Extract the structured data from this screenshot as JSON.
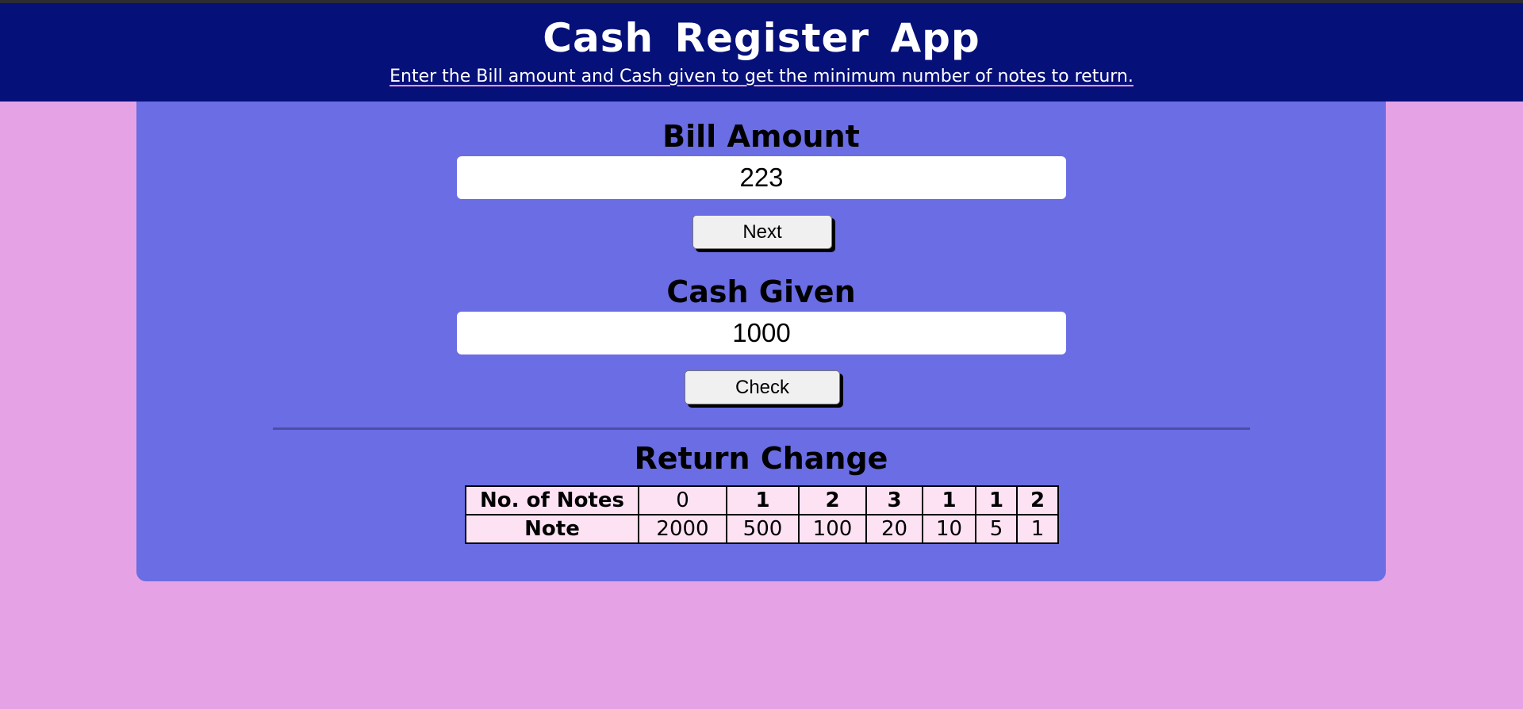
{
  "header": {
    "title": "Cash Register App",
    "subtitle": "Enter the Bill amount and Cash given to get the minimum number of notes to return."
  },
  "bill": {
    "label": "Bill Amount",
    "value": "223",
    "button_label": "Next"
  },
  "cash": {
    "label": "Cash Given",
    "value": "1000",
    "button_label": "Check"
  },
  "result": {
    "heading": "Return Change",
    "row_headers": [
      "No. of Notes",
      "Note"
    ],
    "counts": [
      "0",
      "1",
      "2",
      "3",
      "1",
      "1",
      "2"
    ],
    "notes": [
      "2000",
      "500",
      "100",
      "20",
      "10",
      "5",
      "1"
    ]
  },
  "colors": {
    "page_background": "#e5a3e6",
    "header_background": "#061079",
    "card_background": "#6a6de3",
    "table_cell_background": "#fde2f4",
    "subtitle_underline": "#f29ad6"
  }
}
